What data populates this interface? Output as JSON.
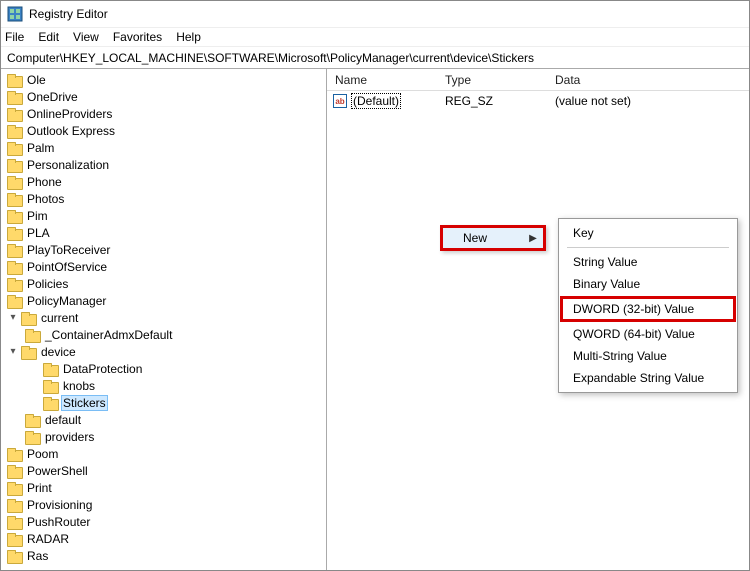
{
  "title": "Registry Editor",
  "menus": [
    "File",
    "Edit",
    "View",
    "Favorites",
    "Help"
  ],
  "address": "Computer\\HKEY_LOCAL_MACHINE\\SOFTWARE\\Microsoft\\PolicyManager\\current\\device\\Stickers",
  "columns": {
    "name": "Name",
    "type": "Type",
    "data": "Data"
  },
  "value_default": {
    "icon": "ab",
    "name": "(Default)",
    "type": "REG_SZ",
    "data": "(value not set)"
  },
  "ctx1": {
    "label": "New"
  },
  "ctx2": {
    "key": "Key",
    "string": "String Value",
    "binary": "Binary Value",
    "dword": "DWORD (32-bit) Value",
    "qword": "QWORD (64-bit) Value",
    "multi": "Multi-String Value",
    "expand": "Expandable String Value"
  },
  "tree": {
    "i0": "Ole",
    "i1": "OneDrive",
    "i2": "OnlineProviders",
    "i3": "Outlook Express",
    "i4": "Palm",
    "i5": "Personalization",
    "i6": "Phone",
    "i7": "Photos",
    "i8": "Pim",
    "i9": "PLA",
    "i10": "PlayToReceiver",
    "i11": "PointOfService",
    "i12": "Policies",
    "i13": "PolicyManager",
    "i14": "current",
    "i15": "_ContainerAdmxDefault",
    "i16": "device",
    "i17": "DataProtection",
    "i18": "knobs",
    "i19": "Stickers",
    "i20": "default",
    "i21": "providers",
    "i22": "Poom",
    "i23": "PowerShell",
    "i24": "Print",
    "i25": "Provisioning",
    "i26": "PushRouter",
    "i27": "RADAR",
    "i28": "Ras"
  }
}
